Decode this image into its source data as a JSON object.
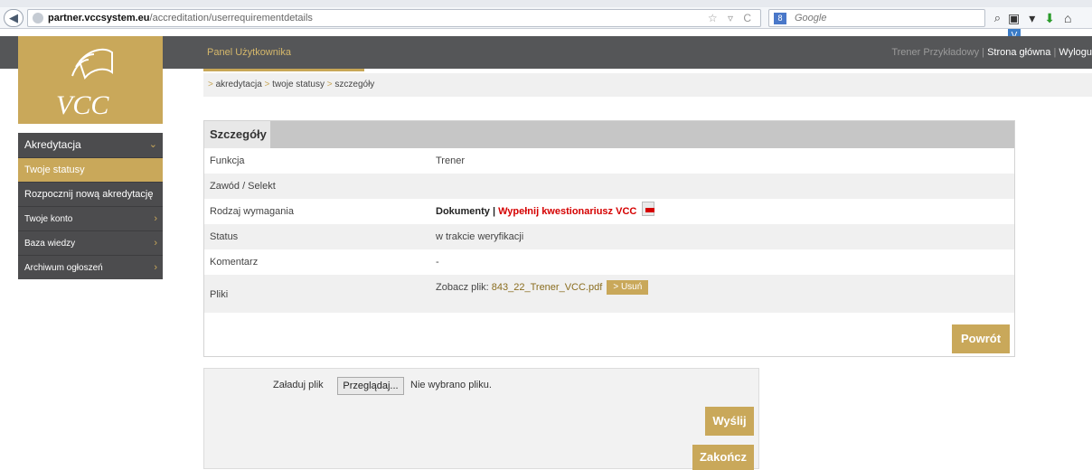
{
  "browser": {
    "back_glyph": "◀",
    "url_domain": "partner.vccsystem.eu",
    "url_path": "/accreditation/userrequirementdetails",
    "url_icons": "☆ ▿ C",
    "search_engine": "8",
    "search_placeholder": "Google",
    "search_glyph": "⌕",
    "toolbar_icons": [
      "▣▾",
      "⬇",
      "⌂",
      "V"
    ]
  },
  "header": {
    "panel_title": "Panel Użytkownika",
    "user_name": "Trener Przykładowy",
    "separator": "|",
    "home_link": "Strona główna",
    "logout_link": "Wylogu"
  },
  "logo": {
    "text": "VCC",
    "color": "#c9a85a"
  },
  "sidebar": {
    "items": [
      {
        "label": "Akredytacja",
        "arrow": "⌄"
      },
      {
        "label": "Twoje statusy"
      },
      {
        "label": "Rozpocznij nową akredytację"
      },
      {
        "label": "Twoje konto",
        "arrow": "›"
      },
      {
        "label": "Baza wiedzy",
        "arrow": "›"
      },
      {
        "label": "Archiwum ogłoszeń",
        "arrow": "›"
      }
    ]
  },
  "breadcrumb": {
    "arrow": ">",
    "items": [
      "akredytacja",
      "twoje statusy",
      "szczegóły"
    ]
  },
  "details": {
    "title": "Szczegóły",
    "rows": [
      {
        "label": "Funkcja",
        "value": "Trener"
      },
      {
        "label": "Zawód / Selekt",
        "value": ""
      },
      {
        "label": "Rodzaj wymagania",
        "value_bold": "Dokumenty",
        "separator": "|",
        "link": "Wypełnij kwestionariusz VCC"
      },
      {
        "label": "Status",
        "value": "w trakcie weryfikacji"
      },
      {
        "label": "Komentarz",
        "value": "-"
      },
      {
        "label": "Pliki",
        "file_prefix": "Zobacz plik:",
        "file_name": "843_22_Trener_VCC.pdf",
        "remove_label": "> Usuń"
      }
    ],
    "back_button": "Powrót"
  },
  "upload": {
    "label": "Załaduj plik",
    "browse_button": "Przeglądaj...",
    "no_file_text": "Nie wybrano pliku.",
    "send_button": "Wyślij",
    "finish_button": "Zakończ"
  },
  "colors": {
    "accent": "#c9a85a",
    "header_bg": "#555658",
    "link_red": "#d50000"
  }
}
